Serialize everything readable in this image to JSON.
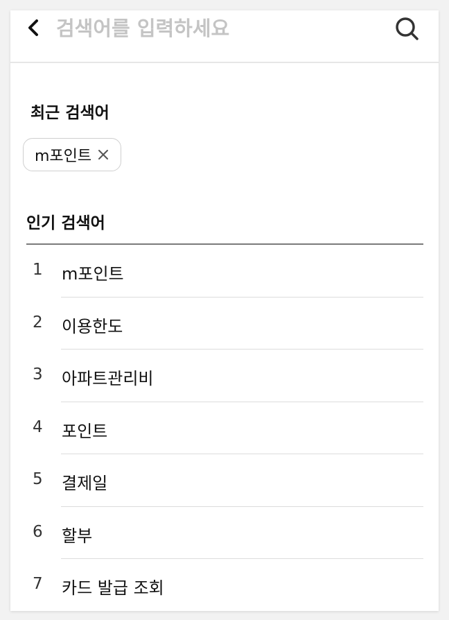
{
  "search": {
    "placeholder": "검색어를 입력하세요",
    "value": ""
  },
  "icons": {
    "back": "chevron-left-icon",
    "search": "magnifier-icon",
    "remove": "close-icon"
  },
  "recent": {
    "title": "최근 검색어",
    "items": [
      {
        "label": "m포인트"
      }
    ]
  },
  "popular": {
    "title": "인기 검색어",
    "items": [
      {
        "rank": "1",
        "term": "m포인트"
      },
      {
        "rank": "2",
        "term": "이용한도"
      },
      {
        "rank": "3",
        "term": "아파트관리비"
      },
      {
        "rank": "4",
        "term": "포인트"
      },
      {
        "rank": "5",
        "term": "결제일"
      },
      {
        "rank": "6",
        "term": "할부"
      },
      {
        "rank": "7",
        "term": "카드 발급 조회"
      }
    ]
  },
  "colors": {
    "background": "#f2f2f2",
    "card": "#ffffff",
    "placeholder": "#c4c4c4",
    "text": "#111111",
    "divider": "#7a7a7a",
    "row_separator": "#dcdcdc"
  }
}
